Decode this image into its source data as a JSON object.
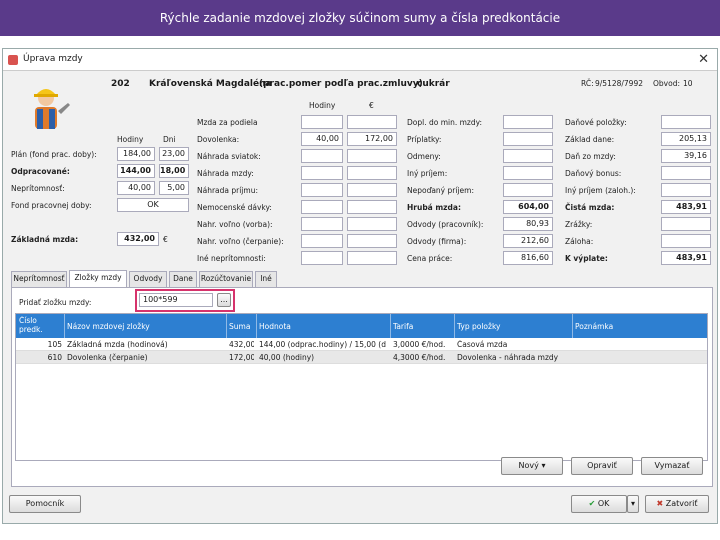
{
  "banner": "Rýchle zadanie mzdovej zložky súčinom sumy a čísla predkontácie",
  "window": {
    "title": "Úprava mzdy",
    "close": "✕"
  },
  "employee": {
    "id": "202",
    "name": "Kráľovenská Magdaléna",
    "contract": "(prac.pomer podľa prac.zmluvy)",
    "position": "cukrár",
    "rc_label": "RČ:",
    "rc_value": "9/5128/7992",
    "obvod_label": "Obvod:",
    "obvod_value": "10"
  },
  "left": {
    "hodiny_label": "Hodiny",
    "dni_label": "Dni",
    "rows": [
      {
        "label": "Plán (fond prac. doby):",
        "hours": "184,00",
        "days": "23,00",
        "bold": false
      },
      {
        "label": "Odpracované:",
        "hours": "144,00",
        "days": "18,00",
        "bold": true
      },
      {
        "label": "Neprítomnosť:",
        "hours": "40,00",
        "days": "5,00",
        "bold": false
      }
    ],
    "fond_label": "Fond pracovnej doby:",
    "fond_value": "OK",
    "zakladna_label": "Základná mzda:",
    "zakladna_value": "432,00",
    "zakladna_unit": "€"
  },
  "middle": {
    "hodiny_label": "Hodiny",
    "euro_label": "€",
    "rows": [
      {
        "label": "Mzda za podiela",
        "h": "",
        "e": ""
      },
      {
        "label": "Dovolenka:",
        "h": "40,00",
        "e": "172,00"
      },
      {
        "label": "Náhrada sviatok:",
        "h": "",
        "e": ""
      },
      {
        "label": "Náhrada mzdy:",
        "h": "",
        "e": ""
      },
      {
        "label": "Náhrada príjmu:",
        "h": "",
        "e": ""
      },
      {
        "label": "Nemocenské dávky:",
        "h": "",
        "e": ""
      },
      {
        "label": "Nahr. voľno (vorba):",
        "h": "",
        "e": ""
      },
      {
        "label": "Nahr. voľno (čerpanie):",
        "h": "",
        "e": ""
      },
      {
        "label": "Iné neprítomnosti:",
        "h": "",
        "e": ""
      }
    ]
  },
  "right1": {
    "rows": [
      {
        "label": "Dopl. do min. mzdy:",
        "v": "",
        "bold": false
      },
      {
        "label": "Príplatky:",
        "v": "",
        "bold": false
      },
      {
        "label": "Odmeny:",
        "v": "",
        "bold": false
      },
      {
        "label": "Iný príjem:",
        "v": "",
        "bold": false
      },
      {
        "label": "Nepoďaný príjem:",
        "v": "",
        "bold": false
      },
      {
        "label": "Hrubá mzda:",
        "v": "604,00",
        "bold": true
      },
      {
        "label": "Odvody (pracovník):",
        "v": "80,93",
        "bold": false
      },
      {
        "label": "Odvody (firma):",
        "v": "212,60",
        "bold": false
      },
      {
        "label": "Cena práce:",
        "v": "816,60",
        "bold": false
      }
    ]
  },
  "right2": {
    "rows": [
      {
        "label": "Daňové položky:",
        "v": "",
        "bold": false
      },
      {
        "label": "Základ dane:",
        "v": "205,13",
        "bold": false
      },
      {
        "label": "Daň zo mzdy:",
        "v": "39,16",
        "bold": false
      },
      {
        "label": "Daňový bonus:",
        "v": "",
        "bold": false
      },
      {
        "label": "Iný príjem (zaloh.):",
        "v": "",
        "bold": false
      },
      {
        "label": "Čistá mzda:",
        "v": "483,91",
        "bold": true
      },
      {
        "label": "Zrážky:",
        "v": "",
        "bold": false
      },
      {
        "label": "Záloha:",
        "v": "",
        "bold": false
      },
      {
        "label": "K výplate:",
        "v": "483,91",
        "bold": true
      }
    ]
  },
  "tabs": [
    "Neprítomnosť",
    "Zložky mzdy",
    "Odvody",
    "Dane",
    "Rozúčtovanie",
    "Iné"
  ],
  "active_tab": 1,
  "add_label": "Pridať zložku mzdy:",
  "add_value": "100*599",
  "add_button": "...",
  "grid": {
    "headers": [
      "Číslo predk.",
      "Názov mzdovej zložky",
      "Suma",
      "Hodnota",
      "Tarifa",
      "Typ položky",
      "Poznámka"
    ],
    "rows": [
      [
        "105",
        "Základná mzda (hodinová)",
        "432,00",
        "144,00 (odprac.hodiny) / 15,00 (d",
        "3,0000 €/hod.",
        "Časová mzda",
        ""
      ],
      [
        "610",
        "Dovolenka (čerpanie)",
        "172,00",
        "40,00 (hodiny)",
        "4,3000 €/hod.",
        "Dovolenka - náhrada mzdy",
        ""
      ]
    ]
  },
  "buttons": {
    "novy": "Nový",
    "opravit": "Opraviť",
    "vymazat": "Vymazať",
    "pomocnik": "Pomocník",
    "ok": "OK",
    "zatvorit": "Zatvoriť"
  }
}
